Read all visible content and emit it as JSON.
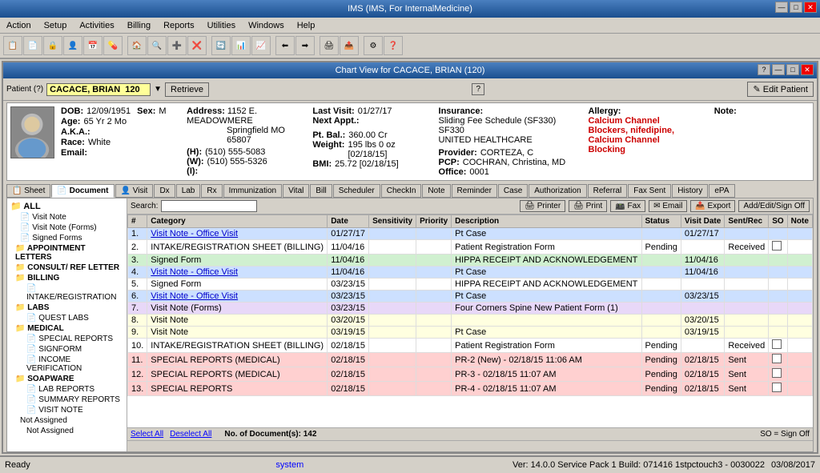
{
  "titleBar": {
    "title": "IMS (IMS, For InternalMedicine)",
    "controls": [
      "—",
      "□",
      "✕"
    ]
  },
  "menuBar": {
    "items": [
      "Action",
      "Setup",
      "Activities",
      "Billing",
      "Reports",
      "Utilities",
      "Windows",
      "Help"
    ]
  },
  "innerWindow": {
    "title": "Chart View for CACACE, BRIAN  (120)",
    "controls": [
      "?",
      "—",
      "□",
      "✕"
    ]
  },
  "patientRow": {
    "label": "Patient (?)",
    "patientName": "CACACE, BRIAN  120",
    "retrieveLabel": "Retrieve",
    "helpLabel": "?",
    "editLabel": "✎ Edit Patient"
  },
  "patientInfo": {
    "dob": "12/09/1951",
    "sex": "M",
    "age": "65 Yr 2 Mo",
    "aka": "",
    "race": "White",
    "email": "",
    "addressLine1": "1152 E. MEADOWMERE",
    "addressLine2": "Springfield  MO  65807",
    "phoneH": "(510) 555-5083",
    "phoneW": "(510) 555-5326",
    "phoneI": "",
    "lastVisit": "01/27/17",
    "nextAppt": "",
    "ptBal": "360.00 Cr",
    "weight": "195 lbs 0 oz [02/18/15]",
    "bmi": "25.72 [02/18/15]",
    "insurance": "Sliding Fee Schedule (SF330)   SF330",
    "insuranceProvider": "UNITED HEALTHCARE",
    "providerCorteza": "CORTEZA, C",
    "pcp": "COCHRAN, Christina, MD",
    "office": "0001",
    "allergy1": "Calcium Channel",
    "allergy2": "Blockers, nifedipine,",
    "allergy3": "Calcium Channel",
    "allergy4": "Blocking",
    "noteLabel": "Note:"
  },
  "tabs": [
    {
      "label": "📋 Sheet",
      "active": false
    },
    {
      "label": "📄 Document",
      "active": true
    },
    {
      "label": "👤 Visit",
      "active": false
    },
    {
      "label": "💊 Dx",
      "active": false
    },
    {
      "label": "🔬 Lab",
      "active": false
    },
    {
      "label": "💊 Rx",
      "active": false
    },
    {
      "label": "💉 Immunization",
      "active": false
    },
    {
      "label": "❤ Vital",
      "active": false
    },
    {
      "label": "💰 Bill",
      "active": false
    },
    {
      "label": "🗓 Scheduler",
      "active": false
    },
    {
      "label": "✓ CheckIn",
      "active": false
    },
    {
      "label": "📝 Note",
      "active": false
    },
    {
      "label": "🔔 Reminder",
      "active": false
    },
    {
      "label": "📁 Case",
      "active": false
    },
    {
      "label": "🔑 Authorization",
      "active": false
    },
    {
      "label": "🔗 Referral",
      "active": false
    },
    {
      "label": "📠 Fax Sent",
      "active": false
    },
    {
      "label": "📜 History",
      "active": false
    },
    {
      "label": "ePA",
      "active": false
    }
  ],
  "leftTree": {
    "items": [
      {
        "label": "ALL",
        "level": "root"
      },
      {
        "label": "Visit Note",
        "level": "item"
      },
      {
        "label": "Visit Note (Forms)",
        "level": "item"
      },
      {
        "label": "Signed Forms",
        "level": "item"
      },
      {
        "label": "APPOINTMENT LETTERS",
        "level": "folder"
      },
      {
        "label": "CONSULT/ REF LETTER",
        "level": "folder"
      },
      {
        "label": "BILLING",
        "level": "folder"
      },
      {
        "label": "INTAKE/REGISTRATION",
        "level": "subitem"
      },
      {
        "label": "LABS",
        "level": "folder"
      },
      {
        "label": "QUEST LABS",
        "level": "subitem"
      },
      {
        "label": "MEDICAL",
        "level": "folder"
      },
      {
        "label": "SPECIAL REPORTS",
        "level": "subitem"
      },
      {
        "label": "SIGNFORM",
        "level": "subitem"
      },
      {
        "label": "INCOME VERIFICATION",
        "level": "subitem"
      },
      {
        "label": "SOAPWARE",
        "level": "folder"
      },
      {
        "label": "LAB REPORTS",
        "level": "subitem"
      },
      {
        "label": "SUMMARY REPORTS",
        "level": "subitem"
      },
      {
        "label": "VISIT NOTE",
        "level": "subitem"
      },
      {
        "label": "Not Assigned",
        "level": "item"
      },
      {
        "label": "Not Assigned",
        "level": "subitem"
      }
    ]
  },
  "docToolbar": {
    "searchLabel": "Search:",
    "searchValue": "",
    "printerLabel": "🖨 Printer",
    "printLabel": "🖨 Print",
    "faxLabel": "📠 Fax",
    "emailLabel": "✉ Email",
    "exportLabel": "📤 Export",
    "addEditLabel": "Add/Edit/Sign Off"
  },
  "tableHeaders": [
    "#",
    "Category",
    "Date",
    "Sensitivity",
    "Priority",
    "Description",
    "Status",
    "Visit Date",
    "Sent/Rec",
    "SO",
    "Note"
  ],
  "tableRows": [
    {
      "num": "1.",
      "category": "Visit Note - Office Visit",
      "date": "01/27/17",
      "sensitivity": "",
      "priority": "",
      "description": "Pt Case",
      "status": "",
      "visitDate": "01/27/17",
      "sentRec": "",
      "so": "",
      "note": "",
      "rowClass": "row-blue",
      "hasLink": true
    },
    {
      "num": "2.",
      "category": "INTAKE/REGISTRATION SHEET (BILLING)",
      "date": "11/04/16",
      "sensitivity": "",
      "priority": "",
      "description": "Patient Registration Form",
      "status": "Pending",
      "visitDate": "",
      "sentRec": "Received",
      "so": "☐",
      "note": "",
      "rowClass": "row-white",
      "hasLink": false
    },
    {
      "num": "3.",
      "category": "Signed Form",
      "date": "11/04/16",
      "sensitivity": "",
      "priority": "",
      "description": "HIPPA RECEIPT AND ACKNOWLEDGEMENT",
      "status": "",
      "visitDate": "11/04/16",
      "sentRec": "",
      "so": "",
      "note": "",
      "rowClass": "row-green",
      "hasLink": false
    },
    {
      "num": "4.",
      "category": "Visit Note - Office Visit",
      "date": "11/04/16",
      "sensitivity": "",
      "priority": "",
      "description": "Pt Case",
      "status": "",
      "visitDate": "11/04/16",
      "sentRec": "",
      "so": "",
      "note": "",
      "rowClass": "row-blue",
      "hasLink": true
    },
    {
      "num": "5.",
      "category": "Signed Form",
      "date": "03/23/15",
      "sensitivity": "",
      "priority": "",
      "description": "HIPPA RECEIPT AND ACKNOWLEDGEMENT",
      "status": "",
      "visitDate": "",
      "sentRec": "",
      "so": "",
      "note": "",
      "rowClass": "row-white",
      "hasLink": false
    },
    {
      "num": "6.",
      "category": "Visit Note - Office Visit",
      "date": "03/23/15",
      "sensitivity": "",
      "priority": "",
      "description": "Pt Case",
      "status": "",
      "visitDate": "03/23/15",
      "sentRec": "",
      "so": "",
      "note": "",
      "rowClass": "row-blue",
      "hasLink": true
    },
    {
      "num": "7.",
      "category": "Visit Note (Forms)",
      "date": "03/23/15",
      "sensitivity": "",
      "priority": "",
      "description": "Four Corners Spine New Patient Form (1)",
      "status": "",
      "visitDate": "",
      "sentRec": "",
      "so": "",
      "note": "",
      "rowClass": "row-lavender",
      "hasLink": false
    },
    {
      "num": "8.",
      "category": "Visit Note",
      "date": "03/20/15",
      "sensitivity": "",
      "priority": "",
      "description": "",
      "status": "",
      "visitDate": "03/20/15",
      "sentRec": "",
      "so": "",
      "note": "",
      "rowClass": "row-yellow",
      "hasLink": false
    },
    {
      "num": "9.",
      "category": "Visit Note",
      "date": "03/19/15",
      "sensitivity": "",
      "priority": "",
      "description": "Pt Case",
      "status": "",
      "visitDate": "03/19/15",
      "sentRec": "",
      "so": "",
      "note": "",
      "rowClass": "row-yellow",
      "hasLink": false
    },
    {
      "num": "10.",
      "category": "INTAKE/REGISTRATION SHEET (BILLING)",
      "date": "02/18/15",
      "sensitivity": "",
      "priority": "",
      "description": "Patient Registration Form",
      "status": "Pending",
      "visitDate": "",
      "sentRec": "Received",
      "so": "☐",
      "note": "",
      "rowClass": "row-white",
      "hasLink": false
    },
    {
      "num": "11.",
      "category": "SPECIAL REPORTS (MEDICAL)",
      "date": "02/18/15",
      "sensitivity": "",
      "priority": "",
      "description": "PR-2 (New) - 02/18/15 11:06 AM",
      "status": "Pending",
      "visitDate": "02/18/15",
      "sentRec": "Sent",
      "so": "☐",
      "note": "",
      "rowClass": "row-pink",
      "hasLink": false
    },
    {
      "num": "12.",
      "category": "SPECIAL REPORTS (MEDICAL)",
      "date": "02/18/15",
      "sensitivity": "",
      "priority": "",
      "description": "PR-3 - 02/18/15 11:07 AM",
      "status": "Pending",
      "visitDate": "02/18/15",
      "sentRec": "Sent",
      "so": "☐",
      "note": "",
      "rowClass": "row-pink",
      "hasLink": false
    },
    {
      "num": "13.",
      "category": "SPECIAL REPORTS",
      "date": "02/18/15",
      "sensitivity": "",
      "priority": "",
      "description": "PR-4 - 02/18/15 11:07 AM",
      "status": "Pending",
      "visitDate": "02/18/15",
      "sentRec": "Sent",
      "so": "☐",
      "note": "",
      "rowClass": "row-pink",
      "hasLink": false
    }
  ],
  "tableFooter": {
    "selectAll": "Select All",
    "deselectAll": "Deselect All",
    "docCount": "No. of Document(s): 142",
    "soNote": "SO = Sign Off"
  },
  "statusBar": {
    "ready": "Ready",
    "system": "system",
    "version": "Ver: 14.0.0 Service Pack 1    Build: 071416    1stpctouch3 - 0030022",
    "date": "03/08/2017"
  }
}
